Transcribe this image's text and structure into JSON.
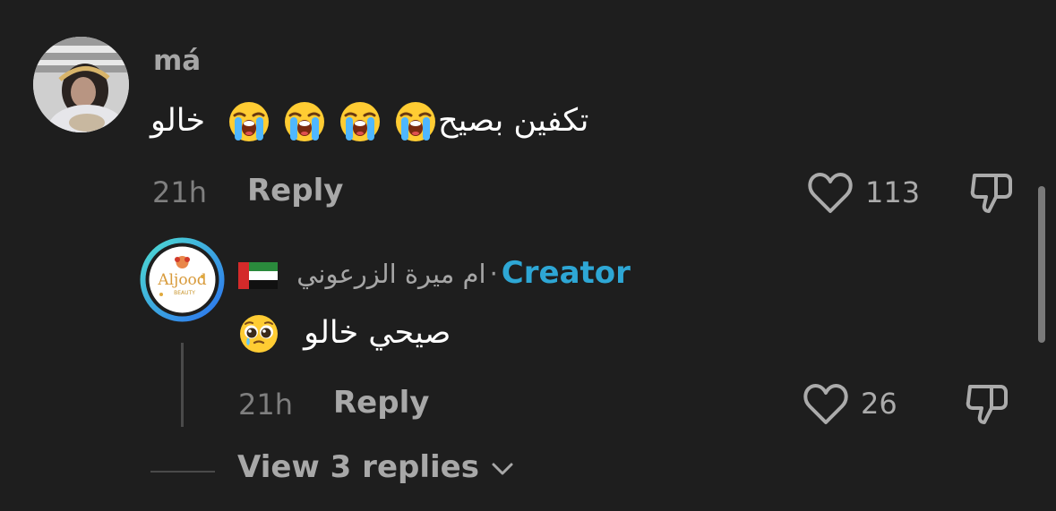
{
  "comment": {
    "username": "má",
    "text": "تكفين بصيح",
    "text_suffix": "خالو",
    "emoji_count": 4,
    "time": "21h",
    "reply_label": "Reply",
    "likes": "113"
  },
  "reply": {
    "badge": "Creator",
    "separator": "·",
    "name": "ام ميرة الزرعوني",
    "flag": "🇦🇪",
    "text": "صيحي خالو",
    "avatar_logo_text": "Aljood",
    "avatar_logo_sub": "BEAUTY",
    "time": "21h",
    "reply_label": "Reply",
    "likes": "26"
  },
  "view_replies": {
    "label": "View 3 replies"
  },
  "icons": {
    "like": "heart-outline-icon",
    "dislike": "thumbs-down-outline-icon",
    "chevron": "chevron-down-icon",
    "crying": "loudly-crying-face-icon",
    "pleading": "pleading-face-icon",
    "flag": "uae-flag-icon"
  },
  "colors": {
    "background": "#1e1e1e",
    "creator_badge": "#2ea7d5",
    "avatar_ring_start": "#4fe0d0",
    "avatar_ring_end": "#2a6ff0"
  }
}
